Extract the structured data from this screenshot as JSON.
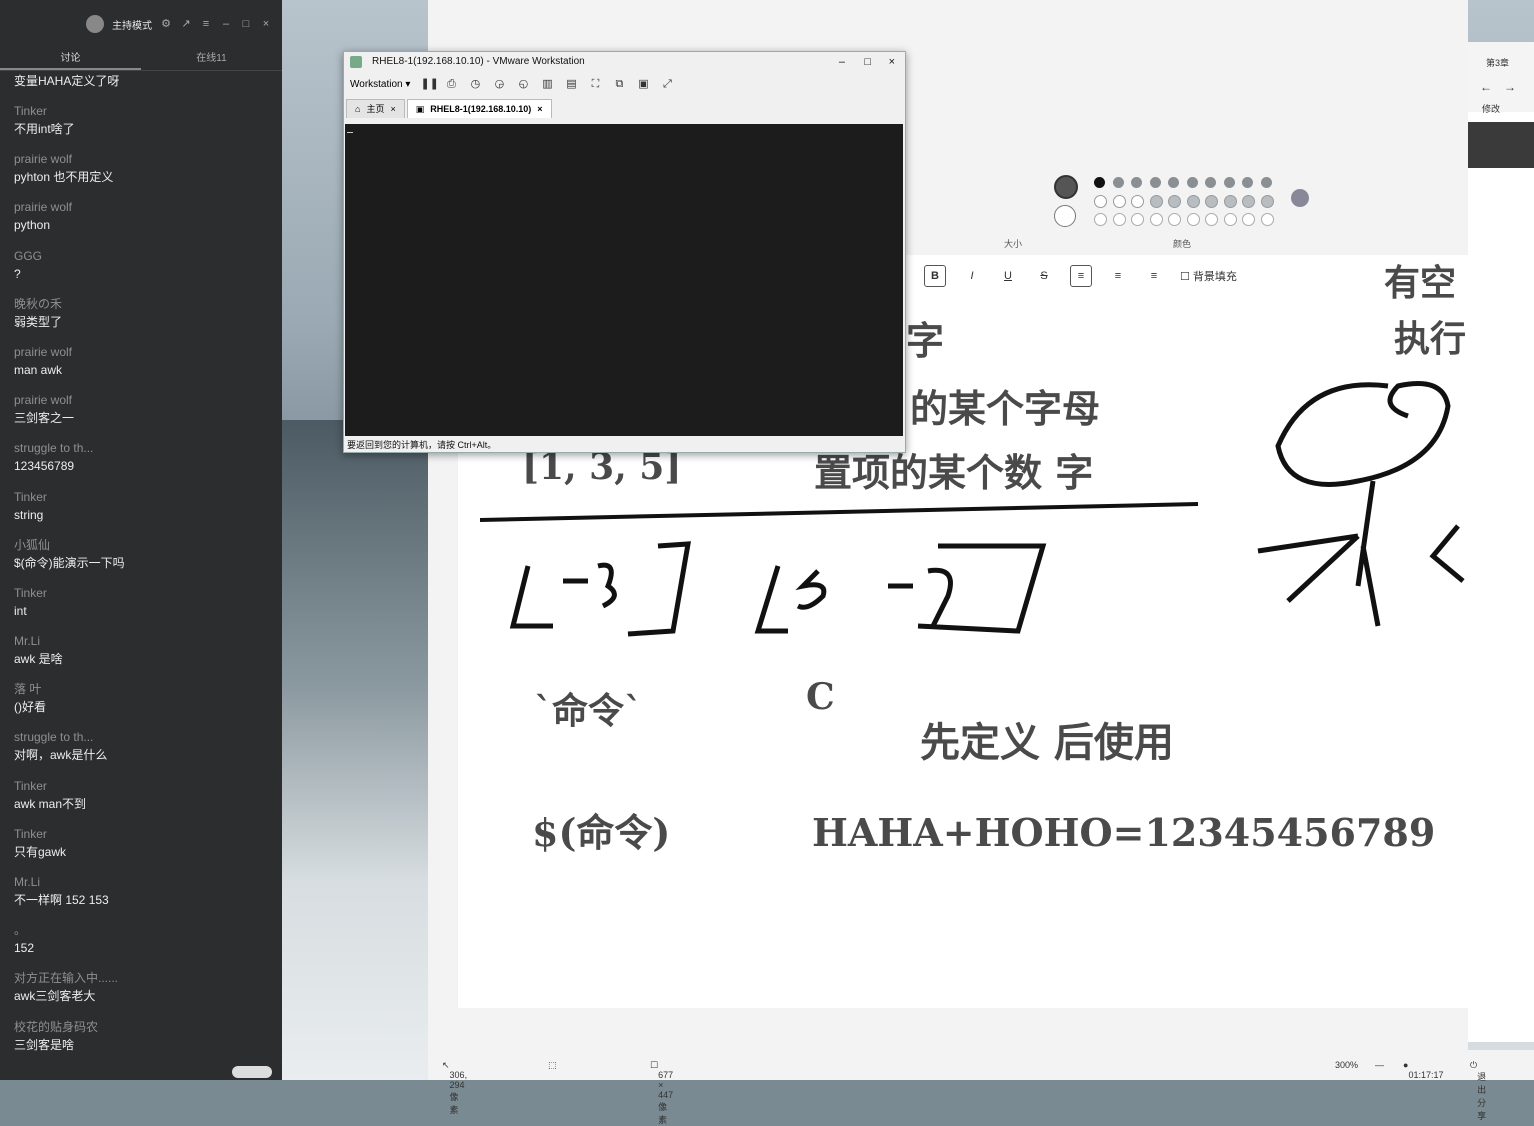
{
  "chat": {
    "host_mode": "主持模式",
    "tabs": [
      "讨论",
      "在线11"
    ],
    "messages": [
      {
        "user": "",
        "text": "变量HAHA定义了呀"
      },
      {
        "user": "Tinker",
        "text": "不用int啥了"
      },
      {
        "user": "prairie wolf",
        "text": "pyhton 也不用定义"
      },
      {
        "user": "prairie wolf",
        "text": "python"
      },
      {
        "user": "GGG",
        "text": "?"
      },
      {
        "user": "晚秋の禾",
        "text": "弱类型了"
      },
      {
        "user": "prairie wolf",
        "text": "man awk"
      },
      {
        "user": "prairie wolf",
        "text": "三剑客之一"
      },
      {
        "user": "struggle to th...",
        "text": "123456789"
      },
      {
        "user": "Tinker",
        "text": "string"
      },
      {
        "user": "小狐仙",
        "text": "$(命令)能演示一下吗"
      },
      {
        "user": "Tinker",
        "text": "int"
      },
      {
        "user": "Mr.Li",
        "text": "awk   是啥"
      },
      {
        "user": "   落   叶",
        "text": "()好看"
      },
      {
        "user": "struggle to th...",
        "text": "对啊，awk是什么"
      },
      {
        "user": "Tinker",
        "text": "awk man不到"
      },
      {
        "user": "Tinker",
        "text": "只有gawk"
      },
      {
        "user": "Mr.Li",
        "text": "不一样啊 152  153"
      },
      {
        "user": "。",
        "text": "152"
      },
      {
        "user": "对方正在输入中......",
        "text": "awk三剑客老大"
      },
      {
        "user": "校花的贴身码农",
        "text": "三剑客是啥"
      }
    ]
  },
  "vmware": {
    "title": "RHEL8-1(192.168.10.10) - VMware Workstation",
    "menu": "Workstation",
    "tabs": [
      "主页",
      "RHEL8-1(192.168.10.10)"
    ],
    "status": "要返回到您的计算机，请按 Ctrl+Alt。"
  },
  "paint": {
    "size_label": "大小",
    "color_label": "颜色",
    "bg_fill": "背景填充",
    "canvas_text": {
      "list": "[1, 3, 5]",
      "line1": "字",
      "line2": "的某个字母",
      "line3": "置项的某个数 字",
      "cmd1": "`命令`",
      "c": "C",
      "define": "先定义  后使用",
      "cmd2": "$(命令)",
      "sum": "HAHA+HOHO=12345456789",
      "right1": "有空",
      "right2": "执行"
    },
    "status": {
      "cursor": "306, 294像素",
      "canvas_size": "677 × 447像素",
      "zoom": "300%",
      "time": "01:17:17",
      "exit": "退出分享"
    }
  },
  "browser": {
    "tab": "第3章",
    "edit": "修改"
  }
}
